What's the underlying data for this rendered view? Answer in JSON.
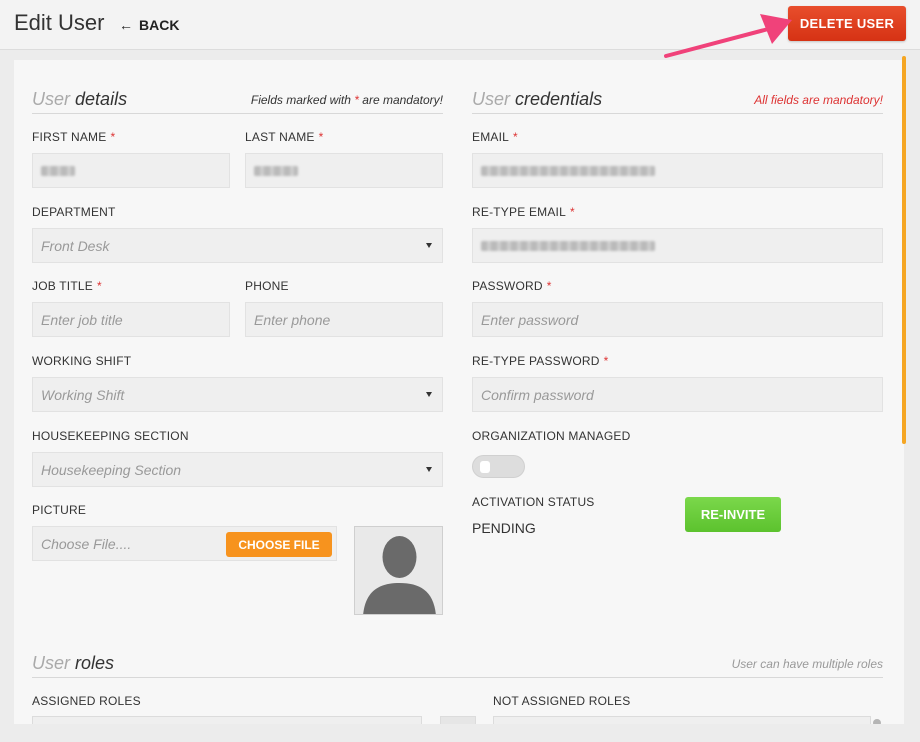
{
  "header": {
    "title": "Edit User",
    "back_label": "BACK",
    "delete_label": "DELETE USER"
  },
  "user_details": {
    "title_light": "User",
    "title_strong": "details",
    "note_prefix": "Fields marked with",
    "note_star": "*",
    "note_suffix": "are mandatory!",
    "first_name_label": "FIRST NAME",
    "last_name_label": "LAST NAME",
    "department_label": "DEPARTMENT",
    "department_value": "Front Desk",
    "job_title_label": "JOB TITLE",
    "job_title_placeholder": "Enter job title",
    "phone_label": "PHONE",
    "phone_placeholder": "Enter phone",
    "working_shift_label": "WORKING SHIFT",
    "working_shift_placeholder": "Working Shift",
    "housekeeping_label": "HOUSEKEEPING SECTION",
    "housekeeping_placeholder": "Housekeeping Section",
    "picture_label": "PICTURE",
    "picture_placeholder": "Choose File....",
    "choose_file_label": "CHOOSE FILE",
    "required_mark": "*"
  },
  "user_credentials": {
    "title_light": "User",
    "title_strong": "credentials",
    "note": "All fields are mandatory!",
    "email_label": "EMAIL",
    "retype_email_label": "RE-TYPE EMAIL",
    "password_label": "PASSWORD",
    "password_placeholder": "Enter password",
    "retype_password_label": "RE-TYPE PASSWORD",
    "retype_password_placeholder": "Confirm password",
    "org_managed_label": "ORGANIZATION MANAGED",
    "org_managed_on": false,
    "activation_label": "ACTIVATION STATUS",
    "activation_value": "PENDING",
    "reinvite_label": "RE-INVITE",
    "required_mark": "*"
  },
  "user_roles": {
    "title_light": "User",
    "title_strong": "roles",
    "note": "User can have multiple roles",
    "assigned_label": "ASSIGNED ROLES",
    "not_assigned_label": "NOT ASSIGNED ROLES"
  },
  "colors": {
    "delete": "#d63214",
    "choose_file": "#f7931e",
    "reinvite": "#5cc22e",
    "required": "#dd3333",
    "scrollbar": "#f5a623"
  }
}
